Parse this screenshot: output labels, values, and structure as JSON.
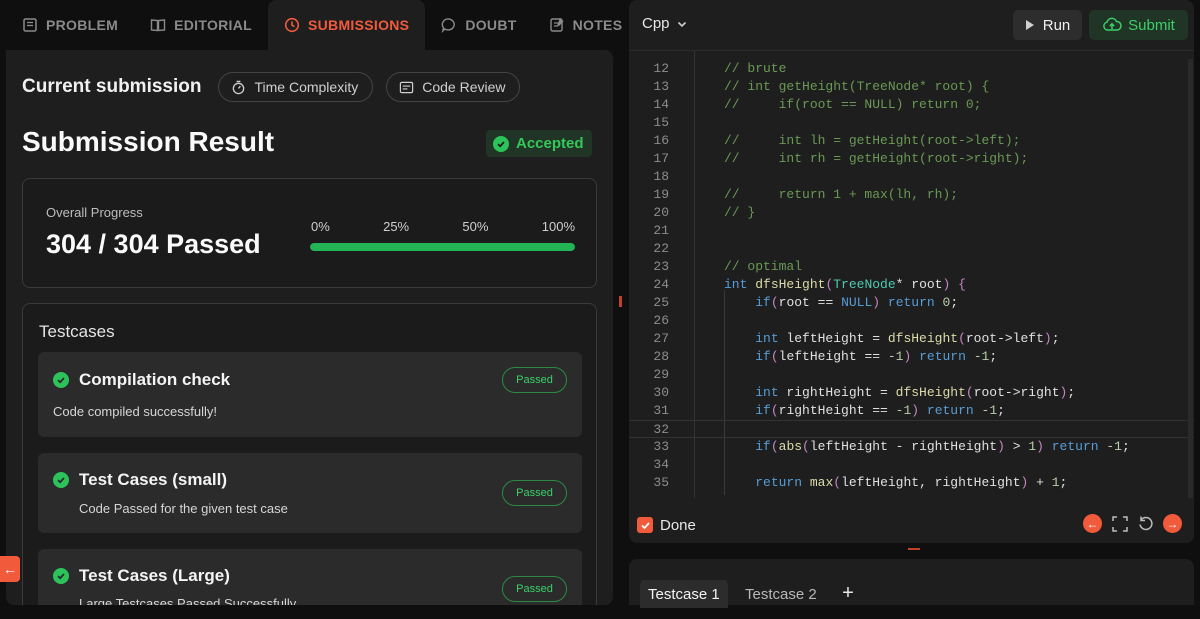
{
  "tabs": [
    {
      "label": "PROBLEM",
      "icon": "book-icon"
    },
    {
      "label": "EDITORIAL",
      "icon": "open-book-icon"
    },
    {
      "label": "SUBMISSIONS",
      "icon": "clock-icon"
    },
    {
      "label": "DOUBT",
      "icon": "chat-icon"
    },
    {
      "label": "NOTES",
      "icon": "notes-icon"
    }
  ],
  "current": {
    "title": "Current submission",
    "time_complexity": "Time Complexity",
    "code_review": "Code Review"
  },
  "result": {
    "title": "Submission Result",
    "status": "Accepted",
    "status_color": "#34c759"
  },
  "progress": {
    "label": "Overall Progress",
    "value": "304 / 304 Passed",
    "ticks": [
      "0%",
      "25%",
      "50%",
      "100%"
    ],
    "percent": 100
  },
  "testcases": {
    "heading": "Testcases",
    "items": [
      {
        "name": "Compilation check",
        "desc": "Code compiled successfully!",
        "badge": "Passed"
      },
      {
        "name": "Test Cases (small)",
        "desc": "Code Passed for the given test case",
        "badge": "Passed"
      },
      {
        "name": "Test Cases (Large)",
        "desc": "Large Testcases Passed Successfully",
        "badge": "Passed"
      }
    ]
  },
  "editor": {
    "language": "Cpp",
    "run_label": "Run",
    "submit_label": "Submit",
    "done_label": "Done",
    "lines": [
      {
        "n": "12",
        "t": "// brute"
      },
      {
        "n": "13",
        "t": "// int getHeight(TreeNode* root) {"
      },
      {
        "n": "14",
        "t": "//     if(root == NULL) return 0;"
      },
      {
        "n": "15",
        "t": ""
      },
      {
        "n": "16",
        "t": "//     int lh = getHeight(root->left);"
      },
      {
        "n": "17",
        "t": "//     int rh = getHeight(root->right);"
      },
      {
        "n": "18",
        "t": ""
      },
      {
        "n": "19",
        "t": "//     return 1 + max(lh, rh);"
      },
      {
        "n": "20",
        "t": "// }"
      },
      {
        "n": "21",
        "t": ""
      },
      {
        "n": "22",
        "t": ""
      },
      {
        "n": "23",
        "t": "// optimal"
      },
      {
        "n": "24",
        "t": "int dfsHeight(TreeNode* root) {"
      },
      {
        "n": "25",
        "t": "    if(root == NULL) return 0;"
      },
      {
        "n": "26",
        "t": ""
      },
      {
        "n": "27",
        "t": "    int leftHeight = dfsHeight(root->left);"
      },
      {
        "n": "28",
        "t": "    if(leftHeight == -1) return -1;"
      },
      {
        "n": "29",
        "t": ""
      },
      {
        "n": "30",
        "t": "    int rightHeight = dfsHeight(root->right);"
      },
      {
        "n": "31",
        "t": "    if(rightHeight == -1) return -1;"
      },
      {
        "n": "32",
        "t": ""
      },
      {
        "n": "33",
        "t": "    if(abs(leftHeight - rightHeight) > 1) return -1;"
      },
      {
        "n": "34",
        "t": ""
      },
      {
        "n": "35",
        "t": "    return max(leftHeight, rightHeight) + 1;"
      }
    ]
  },
  "bottom": {
    "case1": "Testcase 1",
    "case2": "Testcase 2",
    "add": "+"
  }
}
